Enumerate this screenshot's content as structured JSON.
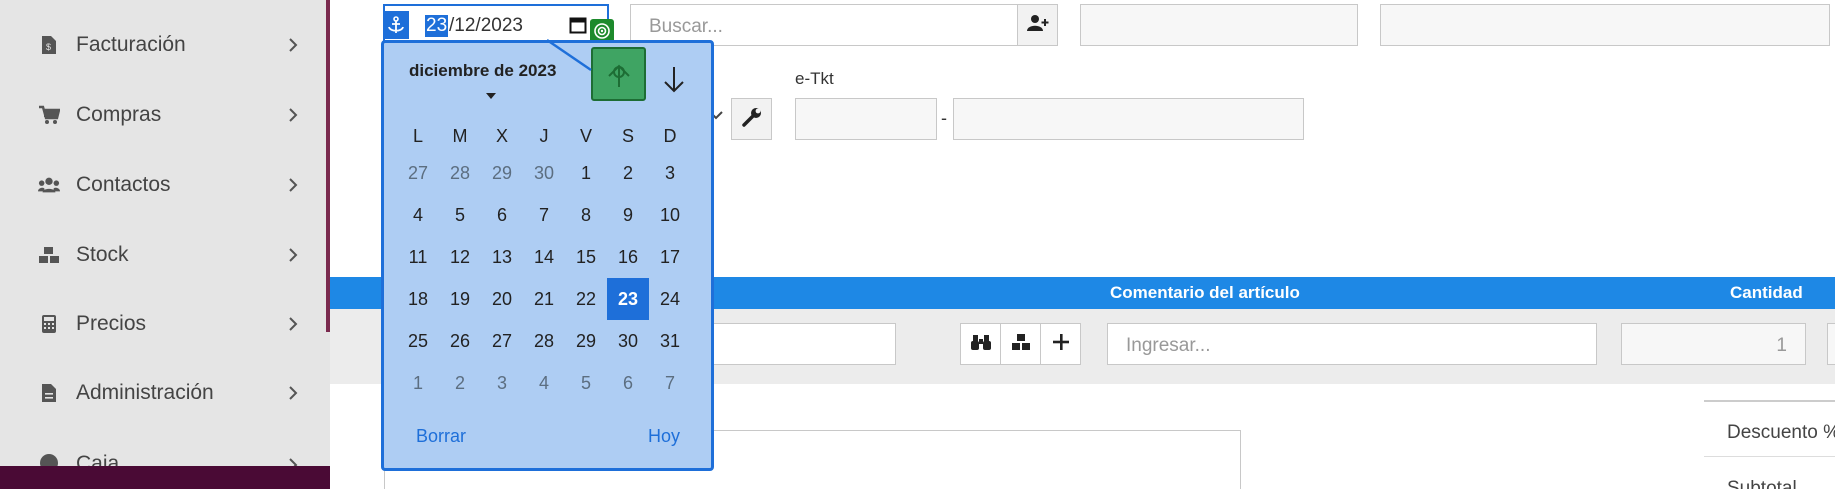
{
  "sidebar": {
    "items": [
      {
        "label": "Facturación",
        "icon": "invoice-icon"
      },
      {
        "label": "Compras",
        "icon": "cart-icon"
      },
      {
        "label": "Contactos",
        "icon": "users-icon"
      },
      {
        "label": "Stock",
        "icon": "boxes-icon"
      },
      {
        "label": "Precios",
        "icon": "calculator-icon"
      },
      {
        "label": "Administración",
        "icon": "file-icon"
      },
      {
        "label": "Caja",
        "icon": "cash-icon"
      }
    ]
  },
  "date_field": {
    "day": "23",
    "rest": "/12/2023"
  },
  "search": {
    "placeholder": "Buscar..."
  },
  "etkt": {
    "label": "e-Tkt",
    "separator": "-"
  },
  "calendar": {
    "month_label": "diciembre de 2023",
    "weekdays": [
      "L",
      "M",
      "X",
      "J",
      "V",
      "S",
      "D"
    ],
    "weeks": [
      [
        "27",
        "28",
        "29",
        "30",
        "1",
        "2",
        "3"
      ],
      [
        "4",
        "5",
        "6",
        "7",
        "8",
        "9",
        "10"
      ],
      [
        "11",
        "12",
        "13",
        "14",
        "15",
        "16",
        "17"
      ],
      [
        "18",
        "19",
        "20",
        "21",
        "22",
        "23",
        "24"
      ],
      [
        "25",
        "26",
        "27",
        "28",
        "29",
        "30",
        "31"
      ],
      [
        "1",
        "2",
        "3",
        "4",
        "5",
        "6",
        "7"
      ]
    ],
    "selected": "23",
    "clear_label": "Borrar",
    "today_label": "Hoy"
  },
  "table": {
    "col_comment": "Comentario del artículo",
    "col_quantity": "Cantidad",
    "comment_placeholder": "Ingresar...",
    "quantity_value": "1"
  },
  "totals": {
    "discount_label": "Descuento %",
    "subtotal_label": "Subtotal"
  },
  "colors": {
    "accent": "#1e88e5",
    "calendar_bg": "#aecdf3",
    "sidebar_bg": "#e5e5e5"
  }
}
